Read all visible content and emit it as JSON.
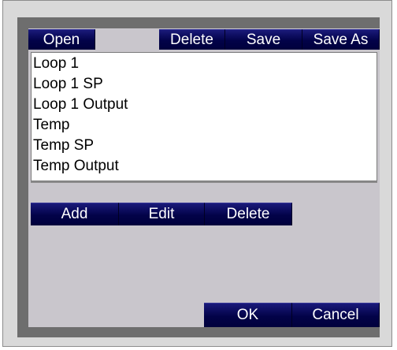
{
  "toolbar": {
    "open_label": "Open",
    "delete_label": "Delete",
    "save_label": "Save",
    "save_as_label": "Save As"
  },
  "list": {
    "items": [
      "Loop 1",
      "Loop 1 SP",
      "Loop 1 Output",
      "Temp",
      "Temp SP",
      "Temp Output"
    ]
  },
  "actions": {
    "add_label": "Add",
    "edit_label": "Edit",
    "delete_label": "Delete"
  },
  "dialog": {
    "ok_label": "OK",
    "cancel_label": "Cancel"
  }
}
